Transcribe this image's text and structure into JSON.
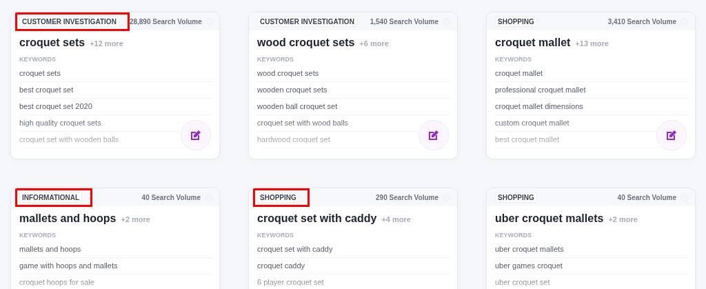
{
  "cards": [
    {
      "tag": "CUSTOMER INVESTIGATION",
      "highlighted": true,
      "volume": "28,890 Search Volume",
      "title": "croquet sets",
      "more": "+12 more",
      "keywords_label": "KEYWORDS",
      "keywords": [
        "croquet sets",
        "best croquet set",
        "best croquet set 2020",
        "high quality croquet sets",
        "croquet set with wooden balls"
      ],
      "edit": true
    },
    {
      "tag": "CUSTOMER INVESTIGATION",
      "highlighted": false,
      "volume": "1,540 Search Volume",
      "title": "wood croquet sets",
      "more": "+6 more",
      "keywords_label": "KEYWORDS",
      "keywords": [
        "wood croquet sets",
        "wooden croquet sets",
        "wooden ball croquet set",
        "croquet set with wood balls",
        "hardwood croquet set"
      ],
      "edit": true
    },
    {
      "tag": "SHOPPING",
      "highlighted": false,
      "volume": "3,410 Search Volume",
      "title": "croquet mallet",
      "more": "+13 more",
      "keywords_label": "KEYWORDS",
      "keywords": [
        "croquet mallet",
        "professional croquet mallet",
        "croquet mallet dimensions",
        "custom croquet mallet",
        "best croquet mallet"
      ],
      "edit": true
    },
    {
      "tag": "INFORMATIONAL",
      "highlighted": true,
      "volume": "40 Search Volume",
      "title": "mallets and hoops",
      "more": "+2 more",
      "keywords_label": "KEYWORDS",
      "keywords": [
        "mallets and hoops",
        "game with hoops and mallets",
        "croquet hoops for sale"
      ]
    },
    {
      "tag": "SHOPPING",
      "highlighted": true,
      "volume": "290 Search Volume",
      "title": "croquet set with caddy",
      "more": "+4 more",
      "keywords_label": "KEYWORDS",
      "keywords": [
        "croquet set with caddy",
        "croquet caddy",
        "6 player croquet set"
      ]
    },
    {
      "tag": "SHOPPING",
      "highlighted": false,
      "volume": "40 Search Volume",
      "title": "uber croquet mallets",
      "more": "+2 more",
      "keywords_label": "KEYWORDS",
      "keywords": [
        "uber croquet mallets",
        "uber games croquet",
        "uber croquet set"
      ]
    }
  ]
}
